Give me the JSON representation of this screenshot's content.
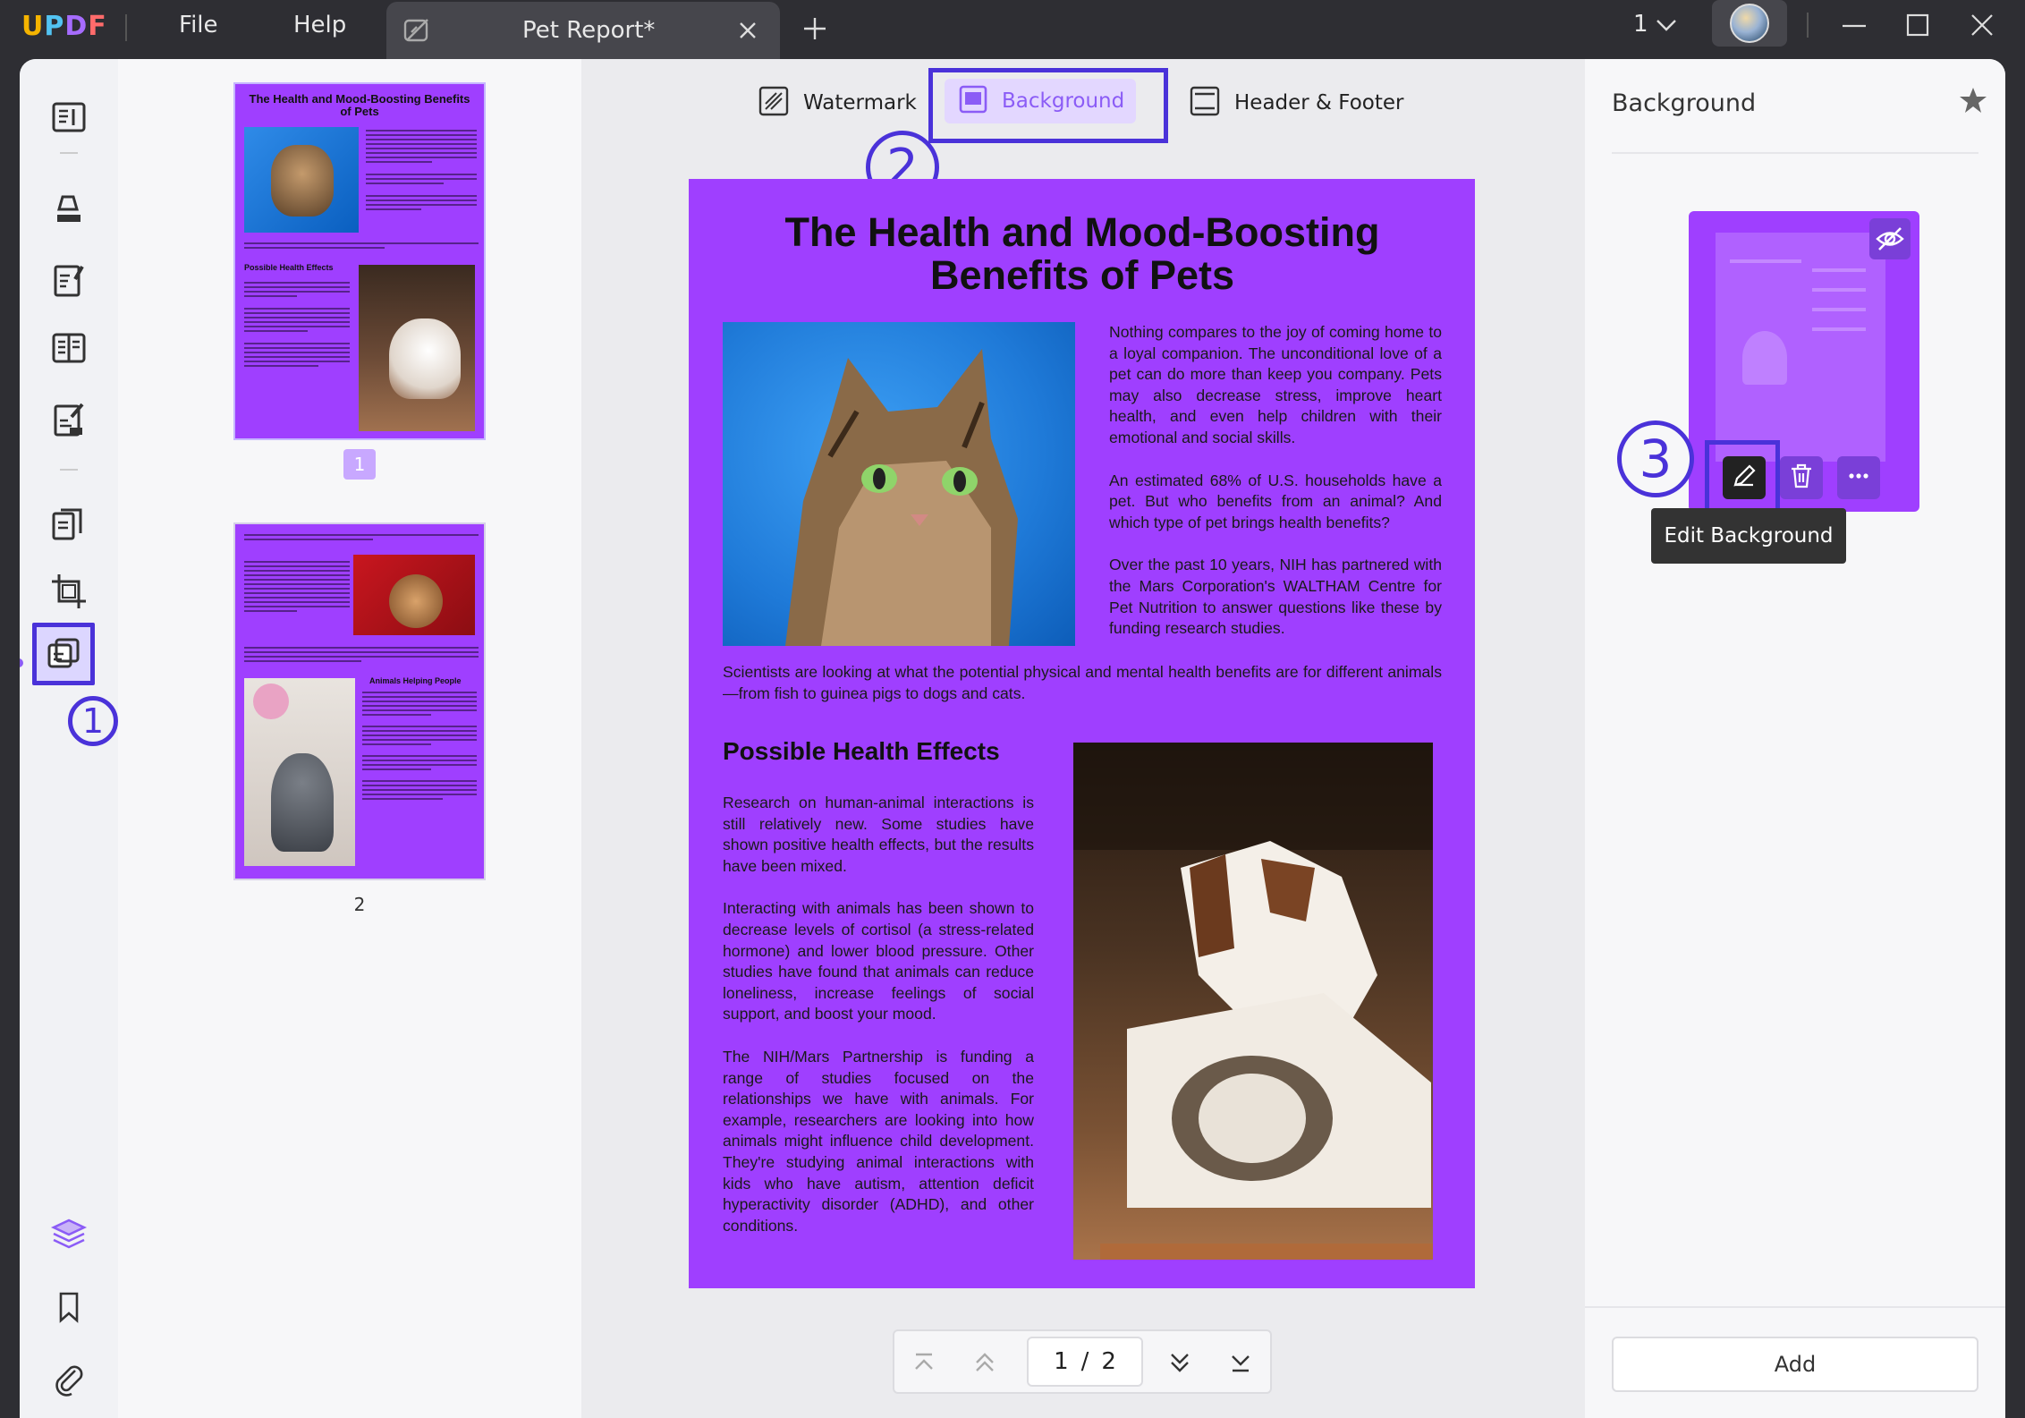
{
  "app": {
    "logo": "UPDF"
  },
  "menu": {
    "file": "File",
    "help": "Help"
  },
  "tab": {
    "title": "Pet Report*"
  },
  "window": {
    "page_indicator": "1"
  },
  "toolbar": {
    "watermark": "Watermark",
    "background": "Background",
    "header_footer": "Header & Footer"
  },
  "thumbnails": {
    "page1_label": "1",
    "page2_label": "2"
  },
  "annotations": {
    "step1": "1",
    "step2": "2",
    "step3": "3"
  },
  "document": {
    "title": "The Health and Mood-Boosting Benefits of Pets",
    "para1": "Nothing compares to the joy of coming home to a loyal companion. The unconditional love of a pet can do more than keep you company. Pets may also decrease stress, improve heart health, and even help children with their emotional and social skills.",
    "para2": "An estimated 68% of U.S. households have a pet. But who benefits from an animal? And which type of pet brings health benefits?",
    "para3": "Over the past 10 years, NIH has partnered with the Mars Corporation's WALTHAM Centre for Pet Nutrition to answer questions like these by funding research studies.",
    "para4": "Scientists are looking at what the potential physical and mental health benefits are for different animals—from fish to guinea pigs to dogs and cats.",
    "heading": "Possible Health Effects",
    "para5": "Research on human-animal interactions is still relatively new. Some studies have shown positive health effects, but the results have been mixed.",
    "para6": "Interacting with animals has been shown to decrease levels of cortisol (a stress-related hormone) and lower blood pressure. Other studies have found that animals can reduce loneliness, increase feelings of social support, and boost your mood.",
    "para7": "The NIH/Mars Partnership is funding a range of studies focused on the relationships we have with animals. For example, researchers are looking into how animals might influence child development. They're studying animal interactions with kids who have autism, attention deficit hyperactivity disorder (ADHD), and other conditions."
  },
  "thumb1": {
    "title": "The Health and Mood-Boosting Benefits of Pets",
    "heading": "Possible Health Effects"
  },
  "thumb2": {
    "heading": "Animals Helping People"
  },
  "pager": {
    "current": "1",
    "separator": "/",
    "total": "2"
  },
  "right_panel": {
    "title": "Background",
    "tooltip": "Edit Background",
    "add_button": "Add"
  },
  "colors": {
    "page_background": "#9f3fff",
    "annotation": "#4a32d9",
    "accent": "#8b5cf6"
  }
}
